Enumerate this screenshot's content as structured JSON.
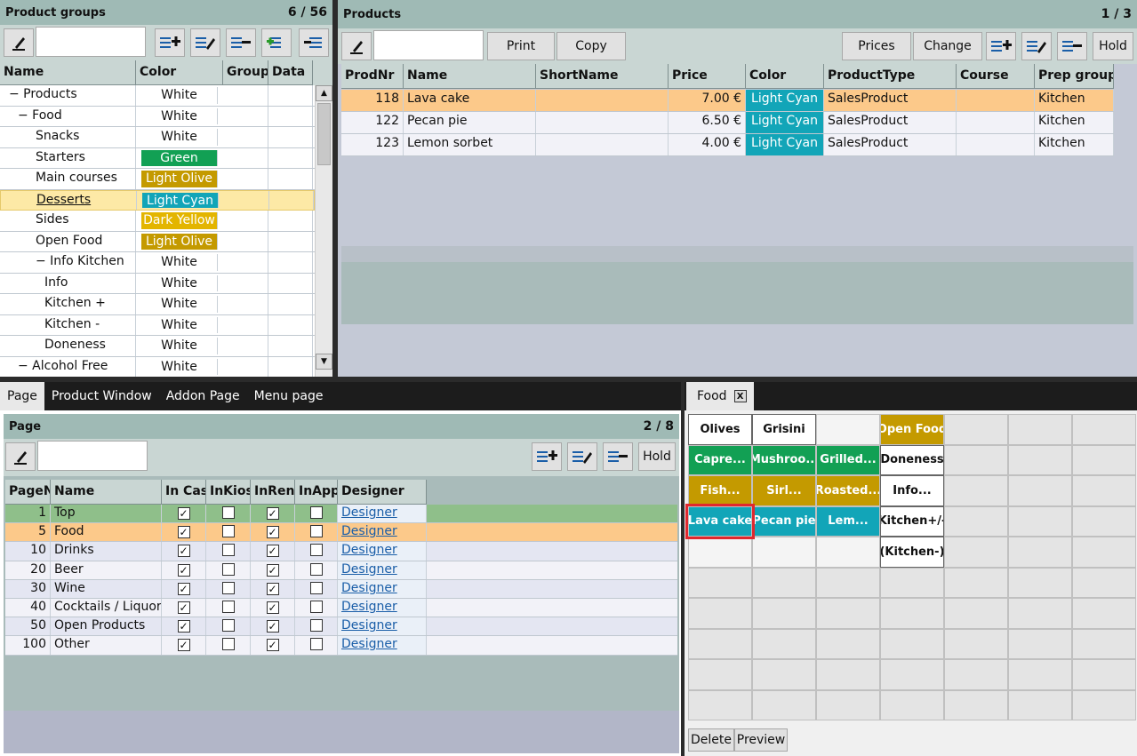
{
  "product_groups": {
    "title": "Product groups",
    "pager": "6  /  56",
    "columns": [
      "Name",
      "Color",
      "Group",
      "Data"
    ],
    "rows": [
      {
        "name": "− Products",
        "color": "White",
        "bg": "#ffffff",
        "fg": "#111111",
        "indent": 10
      },
      {
        "name": "− Food",
        "color": "White",
        "bg": "#ffffff",
        "fg": "#111111",
        "indent": 20
      },
      {
        "name": "Snacks",
        "color": "White",
        "bg": "#ffffff",
        "fg": "#111111",
        "indent": 40
      },
      {
        "name": "Starters",
        "color": "Green",
        "bg": "#12a054",
        "fg": "#ffffff",
        "indent": 40
      },
      {
        "name": "Main courses",
        "color": "Light Olive",
        "bg": "#c49a00",
        "fg": "#ffffff",
        "indent": 40
      },
      {
        "name": "Desserts",
        "color": "Light Cyan",
        "bg": "#12a5b8",
        "fg": "#ffffff",
        "indent": 40
      },
      {
        "name": "Sides",
        "color": "Dark Yellow",
        "bg": "#e3b500",
        "fg": "#ffffff",
        "indent": 40
      },
      {
        "name": "Open Food",
        "color": "Light Olive",
        "bg": "#c49a00",
        "fg": "#ffffff",
        "indent": 40
      },
      {
        "name": "− Info Kitchen",
        "color": "White",
        "bg": "#ffffff",
        "fg": "#111111",
        "indent": 40
      },
      {
        "name": "Info",
        "color": "White",
        "bg": "#ffffff",
        "fg": "#111111",
        "indent": 50
      },
      {
        "name": "Kitchen +",
        "color": "White",
        "bg": "#ffffff",
        "fg": "#111111",
        "indent": 50
      },
      {
        "name": "Kitchen -",
        "color": "White",
        "bg": "#ffffff",
        "fg": "#111111",
        "indent": 50
      },
      {
        "name": "Doneness",
        "color": "White",
        "bg": "#ffffff",
        "fg": "#111111",
        "indent": 50
      },
      {
        "name": "− Alcohol Free",
        "color": "White",
        "bg": "#ffffff",
        "fg": "#111111",
        "indent": 20
      }
    ],
    "selected_index": 5
  },
  "products": {
    "title": "Products",
    "pager": "1  /  3",
    "buttons": {
      "print": "Print",
      "copy": "Copy",
      "prices": "Prices",
      "change": "Change",
      "hold": "Hold"
    },
    "columns": [
      "ProdNr",
      "Name",
      "ShortName",
      "Price",
      "Color",
      "ProductType",
      "Course",
      "Prep group"
    ],
    "rows": [
      {
        "nr": "118",
        "name": "Lava cake",
        "short": "",
        "price": "7.00 €",
        "color": "Light Cyan",
        "type": "SalesProduct",
        "course": "",
        "prep": "Kitchen"
      },
      {
        "nr": "122",
        "name": "Pecan pie",
        "short": "",
        "price": "6.50 €",
        "color": "Light Cyan",
        "type": "SalesProduct",
        "course": "",
        "prep": "Kitchen"
      },
      {
        "nr": "123",
        "name": "Lemon sorbet",
        "short": "",
        "price": "4.00 €",
        "color": "Light Cyan",
        "type": "SalesProduct",
        "course": "",
        "prep": "Kitchen"
      }
    ]
  },
  "tabs": [
    "Page",
    "Product Window",
    "Addon Page",
    "Menu page"
  ],
  "page": {
    "title": "Page",
    "pager": "2  /  8",
    "hold": "Hold",
    "columns": [
      "PageN",
      "Name",
      "In Cas",
      "InKios",
      "InRen",
      "InApp",
      "Designer"
    ],
    "rows": [
      {
        "nr": "1",
        "name": "Top",
        "c1": true,
        "c2": false,
        "c3": true,
        "c4": false,
        "designer": "Designer"
      },
      {
        "nr": "5",
        "name": "Food",
        "c1": true,
        "c2": false,
        "c3": true,
        "c4": false,
        "designer": "Designer"
      },
      {
        "nr": "10",
        "name": "Drinks",
        "c1": true,
        "c2": false,
        "c3": true,
        "c4": false,
        "designer": "Designer"
      },
      {
        "nr": "20",
        "name": "Beer",
        "c1": true,
        "c2": false,
        "c3": true,
        "c4": false,
        "designer": "Designer"
      },
      {
        "nr": "30",
        "name": "Wine",
        "c1": true,
        "c2": false,
        "c3": true,
        "c4": false,
        "designer": "Designer"
      },
      {
        "nr": "40",
        "name": "Cocktails / Liquor",
        "c1": true,
        "c2": false,
        "c3": true,
        "c4": false,
        "designer": "Designer"
      },
      {
        "nr": "50",
        "name": "Open Products",
        "c1": true,
        "c2": false,
        "c3": true,
        "c4": false,
        "designer": "Designer"
      },
      {
        "nr": "100",
        "name": "Other",
        "c1": true,
        "c2": false,
        "c3": true,
        "c4": false,
        "designer": "Designer"
      }
    ]
  },
  "food_designer": {
    "tab_label": "Food",
    "close": "X",
    "buttons": [
      {
        "row": 0,
        "col": 0,
        "label": "Olives",
        "bg": "#ffffff",
        "fg": "#111111"
      },
      {
        "row": 0,
        "col": 1,
        "label": "Grisini",
        "bg": "#ffffff",
        "fg": "#111111"
      },
      {
        "row": 0,
        "col": 3,
        "label": "Open Food",
        "bg": "#c49a00",
        "fg": "#ffffff"
      },
      {
        "row": 1,
        "col": 0,
        "label": "Capre...",
        "bg": "#12a054",
        "fg": "#ffffff"
      },
      {
        "row": 1,
        "col": 1,
        "label": "Mushroo...",
        "bg": "#12a054",
        "fg": "#ffffff"
      },
      {
        "row": 1,
        "col": 2,
        "label": "Grilled...",
        "bg": "#12a054",
        "fg": "#ffffff"
      },
      {
        "row": 1,
        "col": 3,
        "label": "Doneness",
        "bg": "#ffffff",
        "fg": "#111111"
      },
      {
        "row": 2,
        "col": 0,
        "label": "Fish...",
        "bg": "#c49a00",
        "fg": "#ffffff"
      },
      {
        "row": 2,
        "col": 1,
        "label": "Sirl...",
        "bg": "#c49a00",
        "fg": "#ffffff"
      },
      {
        "row": 2,
        "col": 2,
        "label": "Roasted...",
        "bg": "#c49a00",
        "fg": "#ffffff"
      },
      {
        "row": 2,
        "col": 3,
        "label": "Info...",
        "bg": "#ffffff",
        "fg": "#111111"
      },
      {
        "row": 3,
        "col": 0,
        "label": "Lava cake",
        "bg": "#12a5b8",
        "fg": "#ffffff",
        "highlight": true
      },
      {
        "row": 3,
        "col": 1,
        "label": "Pecan pie",
        "bg": "#12a5b8",
        "fg": "#ffffff"
      },
      {
        "row": 3,
        "col": 2,
        "label": "Lem...",
        "bg": "#12a5b8",
        "fg": "#ffffff"
      },
      {
        "row": 3,
        "col": 3,
        "label": "Kitchen+/-",
        "bg": "#ffffff",
        "fg": "#111111"
      },
      {
        "row": 4,
        "col": 3,
        "label": "(Kitchen-)",
        "bg": "#ffffff",
        "fg": "#111111"
      }
    ],
    "delete": "Delete",
    "preview": "Preview"
  }
}
